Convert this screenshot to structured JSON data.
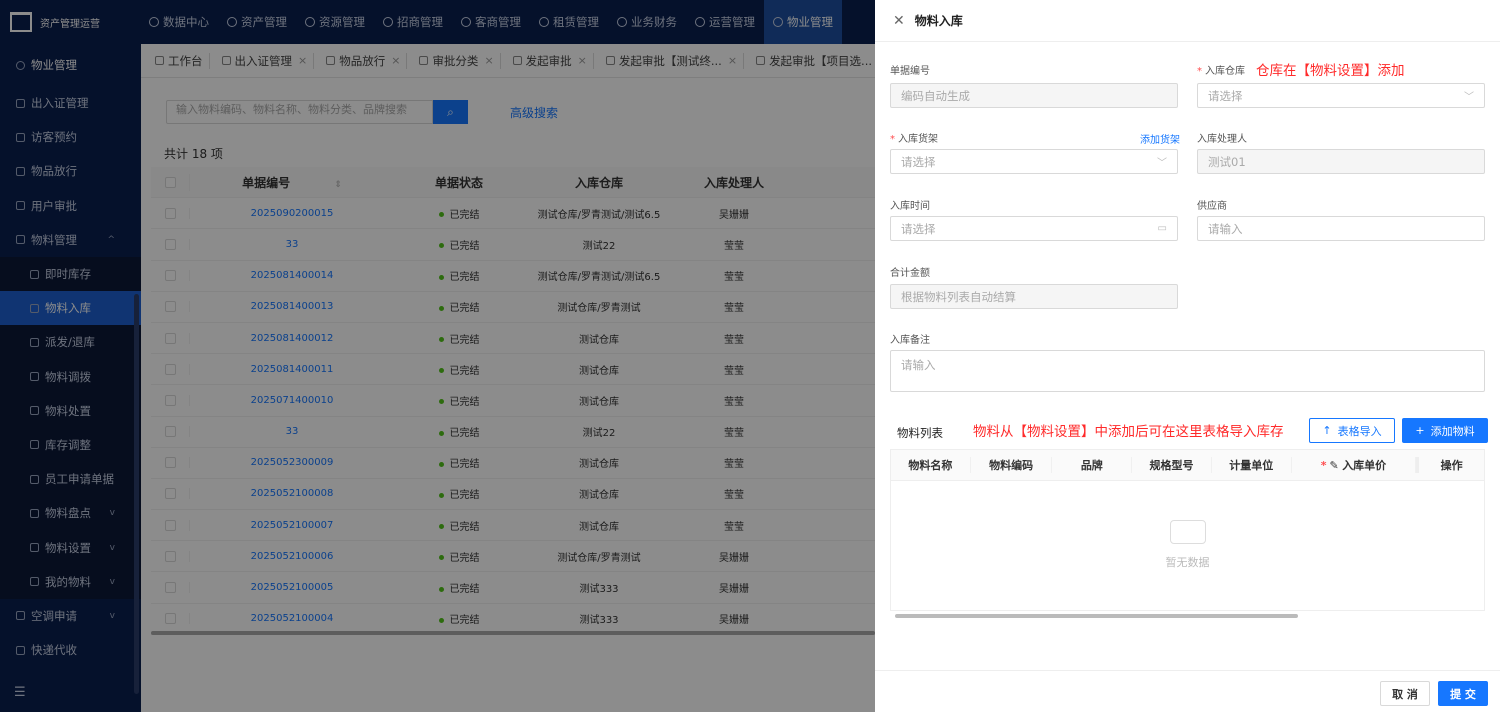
{
  "app": {
    "title": "资产管理运营"
  },
  "topnav": [
    {
      "label": "数据中心",
      "icon": "dashboard-icon"
    },
    {
      "label": "资产管理",
      "icon": "asset-icon"
    },
    {
      "label": "资源管理",
      "icon": "resource-icon"
    },
    {
      "label": "招商管理",
      "icon": "investment-icon"
    },
    {
      "label": "客商管理",
      "icon": "customer-icon"
    },
    {
      "label": "租赁管理",
      "icon": "lease-icon"
    },
    {
      "label": "业务财务",
      "icon": "finance-icon"
    },
    {
      "label": "运营管理",
      "icon": "operation-icon"
    },
    {
      "label": "物业管理",
      "icon": "property-icon",
      "active": true
    }
  ],
  "sidebar": {
    "title": "物业管理",
    "items": [
      {
        "label": "出入证管理"
      },
      {
        "label": "访客预约"
      },
      {
        "label": "物品放行"
      },
      {
        "label": "用户审批"
      },
      {
        "label": "物料管理",
        "arrow": "^"
      },
      {
        "label": "即时库存",
        "sub": true
      },
      {
        "label": "物料入库",
        "sub": true,
        "active": true
      },
      {
        "label": "派发/退库",
        "sub": true
      },
      {
        "label": "物料调拨",
        "sub": true
      },
      {
        "label": "物料处置",
        "sub": true
      },
      {
        "label": "库存调整",
        "sub": true
      },
      {
        "label": "员工申请单据",
        "sub": true
      },
      {
        "label": "物料盘点",
        "sub": true,
        "arrow": "v"
      },
      {
        "label": "物料设置",
        "sub": true,
        "arrow": "v"
      },
      {
        "label": "我的物料",
        "sub": true,
        "arrow": "v"
      },
      {
        "label": "空调申请",
        "arrow": "v"
      },
      {
        "label": "快递代收"
      }
    ],
    "collapse_icon": "☰"
  },
  "tabs": [
    {
      "label": "工作台",
      "closable": false
    },
    {
      "label": "出入证管理",
      "closable": true
    },
    {
      "label": "物品放行",
      "closable": true
    },
    {
      "label": "审批分类",
      "closable": true
    },
    {
      "label": "发起审批",
      "closable": true
    },
    {
      "label": "发起审批【测试终...",
      "closable": true
    },
    {
      "label": "发起审批【项目选...",
      "closable": true
    }
  ],
  "search": {
    "placeholder": "输入物料编码、物料名称、物料分类、品牌搜索",
    "advanced": "高级搜索"
  },
  "count_text": "共计 18 项",
  "table": {
    "headers": [
      "单据编号",
      "单据状态",
      "入库仓库",
      "入库处理人"
    ],
    "rows": [
      {
        "no": "2025090200015",
        "status": "已完结",
        "warehouse": "测试仓库/罗青测试/测试6.5",
        "handler": "吴姗姗"
      },
      {
        "no": "33",
        "status": "已完结",
        "warehouse": "测试22",
        "handler": "莹莹"
      },
      {
        "no": "2025081400014",
        "status": "已完结",
        "warehouse": "测试仓库/罗青测试/测试6.5",
        "handler": "莹莹"
      },
      {
        "no": "2025081400013",
        "status": "已完结",
        "warehouse": "测试仓库/罗青测试",
        "handler": "莹莹"
      },
      {
        "no": "2025081400012",
        "status": "已完结",
        "warehouse": "测试仓库",
        "handler": "莹莹"
      },
      {
        "no": "2025081400011",
        "status": "已完结",
        "warehouse": "测试仓库",
        "handler": "莹莹"
      },
      {
        "no": "2025071400010",
        "status": "已完结",
        "warehouse": "测试仓库",
        "handler": "莹莹"
      },
      {
        "no": "33",
        "status": "已完结",
        "warehouse": "测试22",
        "handler": "莹莹"
      },
      {
        "no": "2025052300009",
        "status": "已完结",
        "warehouse": "测试仓库",
        "handler": "莹莹"
      },
      {
        "no": "2025052100008",
        "status": "已完结",
        "warehouse": "测试仓库",
        "handler": "莹莹"
      },
      {
        "no": "2025052100007",
        "status": "已完结",
        "warehouse": "测试仓库",
        "handler": "莹莹"
      },
      {
        "no": "2025052100006",
        "status": "已完结",
        "warehouse": "测试仓库/罗青测试",
        "handler": "吴姗姗"
      },
      {
        "no": "2025052100005",
        "status": "已完结",
        "warehouse": "测试333",
        "handler": "吴姗姗"
      },
      {
        "no": "2025052100004",
        "status": "已完结",
        "warehouse": "测试333",
        "handler": "吴姗姗"
      }
    ]
  },
  "drawer": {
    "title": "物料入库",
    "doc_no_label": "单据编号",
    "doc_no_value": "编码自动生成",
    "warehouse_label": "入库仓库",
    "warehouse_note": "仓库在【物料设置】添加",
    "warehouse_placeholder": "请选择",
    "shelf_label": "入库货架",
    "add_shelf": "添加货架",
    "shelf_placeholder": "请选择",
    "handler_label": "入库处理人",
    "handler_value": "测试01",
    "time_label": "入库时间",
    "time_placeholder": "请选择",
    "supplier_label": "供应商",
    "supplier_placeholder": "请输入",
    "amount_label": "合计金额",
    "amount_value": "根据物料列表自动结算",
    "remark_label": "入库备注",
    "remark_placeholder": "请输入",
    "list_label": "物料列表",
    "list_note": "物料从【物料设置】中添加后可在这里表格导入库存",
    "import_btn": "表格导入",
    "add_btn": "添加物料",
    "list_headers": [
      "物料名称",
      "物料编码",
      "品牌",
      "规格型号",
      "计量单位",
      "入库单价",
      "操作"
    ],
    "empty_text": "暂无数据",
    "cancel_btn": "取 消",
    "submit_btn": "提 交"
  }
}
